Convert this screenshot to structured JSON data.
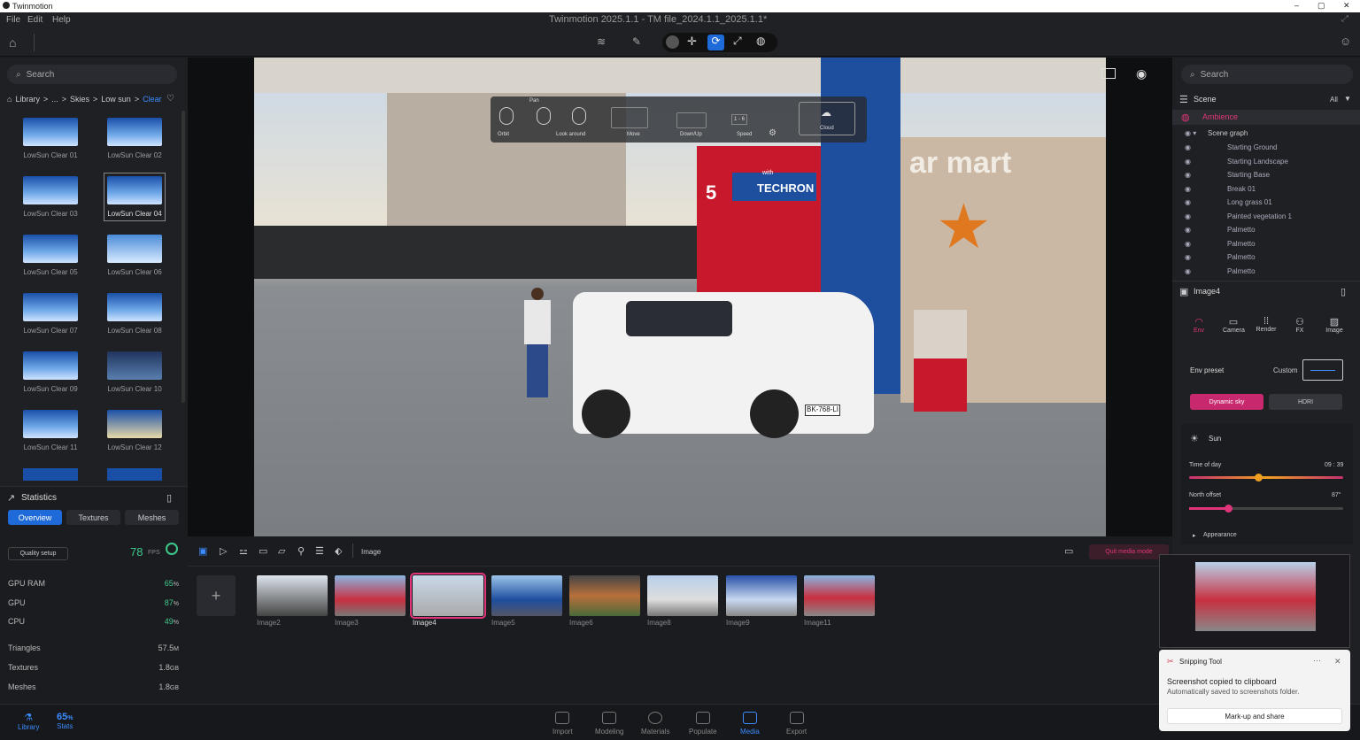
{
  "app": {
    "title": "Twinmotion",
    "window_title": "Twinmotion 2025.1.1 - TM file_2024.1.1_2025.1.1*"
  },
  "menu": [
    "File",
    "Edit",
    "Help"
  ],
  "left": {
    "search_placeholder": "Search",
    "breadcrumb": [
      "Library",
      ">",
      "...",
      ">",
      "Skies",
      ">",
      "Low sun",
      ">",
      "Clear"
    ],
    "skies": [
      "LowSun Clear 01",
      "LowSun Clear 02",
      "LowSun Clear 03",
      "LowSun Clear 04",
      "LowSun Clear 05",
      "LowSun Clear 06",
      "LowSun Clear 07",
      "LowSun Clear 08",
      "LowSun Clear 09",
      "LowSun Clear 10",
      "LowSun Clear 11",
      "LowSun Clear 12"
    ],
    "stats_title": "Statistics",
    "stats_tabs": [
      "Overview",
      "Textures",
      "Meshes"
    ],
    "quality": "Quality setup",
    "fps": "78",
    "fps_unit": "FPS",
    "stats": [
      {
        "k": "GPU RAM",
        "v": "65",
        "u": "%"
      },
      {
        "k": "GPU",
        "v": "87",
        "u": "%"
      },
      {
        "k": "CPU",
        "v": "49",
        "u": "%"
      },
      {
        "k": "Triangles",
        "v": "57.5",
        "u": "M"
      },
      {
        "k": "Textures",
        "v": "1.8",
        "u": "GB"
      },
      {
        "k": "Meshes",
        "v": "1.8",
        "u": "GB"
      }
    ]
  },
  "nav_overlay": {
    "pan": "Pan",
    "items": [
      "Orbit",
      "Look around",
      "Move",
      "Down/Up",
      "Speed"
    ],
    "cloud": "Cloud",
    "speed_val": "1 - 6"
  },
  "scene_text": {
    "store": "ar mart",
    "brand": "TECHRON",
    "brand_small": "with",
    "pump": "5",
    "plate": "BK-768-LI"
  },
  "right": {
    "search_placeholder": "Search",
    "scene": "Scene",
    "all": "All",
    "ambience": "Ambience",
    "scene_graph": "Scene graph",
    "tree": [
      "Starting Ground",
      "Starting Landscape",
      "Starting Base",
      "Break 01",
      "Long grass 01",
      "Painted vegetation 1",
      "Palmetto",
      "Palmetto",
      "Palmetto",
      "Palmetto"
    ],
    "image_title": "Image4",
    "tabs": [
      "Env",
      "Camera",
      "Render",
      "FX",
      "Image"
    ],
    "env_preset": "Env preset",
    "custom": "Custom",
    "dynamic_sky": "Dynamic sky",
    "hdri": "HDRI",
    "sun": "Sun",
    "time_of_day": "Time of day",
    "time_val": "09 : 39",
    "north_offset": "North offset",
    "north_val": "87°",
    "appearance": "Appearance",
    "time_level": 0.45,
    "north_level": 0.25
  },
  "media": {
    "label": "Image",
    "quit": "Quit media mode",
    "items": [
      "Image2",
      "Image3",
      "Image4",
      "Image5",
      "Image6",
      "Image8",
      "Image9",
      "Image11"
    ],
    "selected": "Image4"
  },
  "bottom": {
    "library": "Library",
    "stats_val": "65",
    "stats_unit": "%",
    "stats": "Stats",
    "nav": [
      "Import",
      "Modeling",
      "Materials",
      "Populate",
      "Media",
      "Export"
    ],
    "active": "Media"
  },
  "toast": {
    "app": "Snipping Tool",
    "msg": "Screenshot copied to clipboard",
    "sub": "Automatically saved to screenshots folder.",
    "button": "Mark-up and share"
  }
}
